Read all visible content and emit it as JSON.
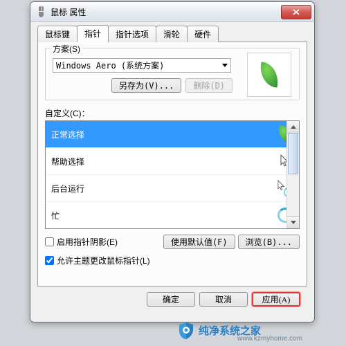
{
  "titlebar": {
    "title": "鼠标 属性"
  },
  "tabs": [
    "鼠标键",
    "指针",
    "指针选项",
    "滑轮",
    "硬件"
  ],
  "active_tab": 1,
  "scheme": {
    "group_title": "方案(S)",
    "value": "Windows Aero (系统方案)",
    "save_as": "另存为(V)...",
    "delete": "删除(D)"
  },
  "custom": {
    "label": "自定义(C)：",
    "items": [
      {
        "label": "正常选择",
        "icon": "leaf",
        "selected": true
      },
      {
        "label": "帮助选择",
        "icon": "help"
      },
      {
        "label": "后台运行",
        "icon": "arrow-ring"
      },
      {
        "label": "忙",
        "icon": "ring"
      }
    ],
    "use_default": "使用默认值(F)",
    "browse": "浏览(B)..."
  },
  "checks": {
    "shadow": "启用指针阴影(E)",
    "allow_theme": "允许主题更改鼠标指针(L)"
  },
  "footer": {
    "ok": "确定",
    "cancel": "取消",
    "apply": "应用(A)"
  },
  "watermark": {
    "brand": "纯净系统之家",
    "url": "www.kzmyhome.com"
  }
}
